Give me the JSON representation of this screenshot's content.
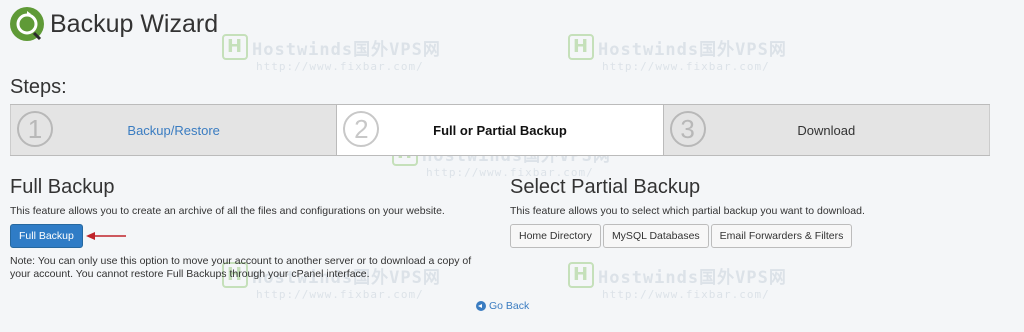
{
  "header": {
    "title": "Backup Wizard"
  },
  "watermark": {
    "brand": "Hostwinds国外VPS网",
    "url": "http://www.fixbar.com/"
  },
  "steps": {
    "heading": "Steps:",
    "items": [
      {
        "number": "1",
        "label": "Backup/Restore",
        "state": "link"
      },
      {
        "number": "2",
        "label": "Full or Partial Backup",
        "state": "active"
      },
      {
        "number": "3",
        "label": "Download",
        "state": "inactive"
      }
    ]
  },
  "full_backup": {
    "title": "Full Backup",
    "description": "This feature allows you to create an archive of all the files and configurations on your website.",
    "button_label": "Full Backup",
    "note": "Note: You can only use this option to move your account to another server or to download a copy of your account. You cannot restore Full Backups through your cPanel interface."
  },
  "partial_backup": {
    "title": "Select Partial Backup",
    "description": "This feature allows you to select which partial backup you want to download.",
    "buttons": [
      "Home Directory",
      "MySQL Databases",
      "Email Forwarders & Filters"
    ]
  },
  "footer": {
    "go_back_label": "Go Back"
  },
  "colors": {
    "primary": "#2f7cc6",
    "link": "#3a7cc1",
    "logo": "#5f9a37",
    "annotation_arrow": "#c0242a"
  }
}
